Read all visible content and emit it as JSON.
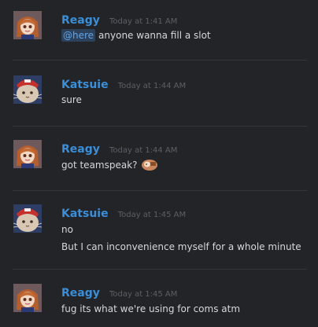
{
  "messages": [
    {
      "author": "Reagy",
      "timestamp": "Today at 1:41 AM",
      "avatar": "anime-girl-avatar",
      "mention": "@here",
      "lines": [
        "anyone wanna fill a slot"
      ]
    },
    {
      "author": "Katsuie",
      "timestamp": "Today at 1:44 AM",
      "avatar": "cat-with-red-hat-avatar",
      "lines": [
        "sure"
      ]
    },
    {
      "author": "Reagy",
      "timestamp": "Today at 1:44 AM",
      "avatar": "anime-girl-avatar",
      "lines": [
        "got teamspeak?"
      ],
      "emoji": "custom-emoji"
    },
    {
      "author": "Katsuie",
      "timestamp": "Today at 1:45 AM",
      "avatar": "cat-with-red-hat-avatar",
      "lines": [
        "no",
        "But I can inconvenience myself for a whole minute"
      ]
    },
    {
      "author": "Reagy",
      "timestamp": "Today at 1:45 AM",
      "avatar": "anime-girl-avatar",
      "lines": [
        "fug its what we're using for coms atm"
      ]
    }
  ],
  "colors": {
    "background": "#232428",
    "author": "#3b8fd8",
    "timestamp": "#5d5f66",
    "text": "#d5d7da",
    "mention_bg": "#2f4d70",
    "mention_text": "#5fa6e8"
  }
}
